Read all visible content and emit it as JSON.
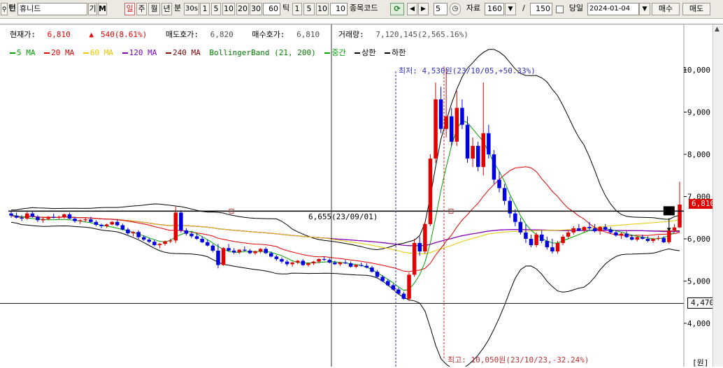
{
  "toolbar": {
    "search_icon": "search-icon",
    "search_prefix": "턴",
    "stock_name": "휴니드",
    "btn_gi": "기",
    "btn_m": "M",
    "period_day": "일",
    "period_week": "주",
    "period_month": "월",
    "period_year": "년",
    "minute_label": "분",
    "interval_30s": "30s",
    "interval_1": "1",
    "interval_5": "5",
    "interval_10": "10",
    "interval_20": "20",
    "interval_30": "30",
    "interval_60": "60",
    "tick_label": "틱",
    "tick_1": "1",
    "tick_5": "5",
    "tick_10": "10",
    "tick_value": "10",
    "stock_code_label": "종목코드",
    "step_value": "5",
    "data_label": "자료",
    "data_count": "160",
    "slash": "/",
    "data_total": "150",
    "sameday_label": "당일",
    "date_value": "2024-01-04",
    "buy_label": "매수",
    "sell_label": "매도"
  },
  "info": {
    "price_label": "현재가:",
    "price_value": "6,810",
    "change_value": "540(8.61%)",
    "ask_label": "매도호가:",
    "ask_value": "6,820",
    "bid_label": "매수호가:",
    "bid_value": "6,810",
    "volume_label": "거래량:",
    "volume_value": "7,120,145(2,565.16%)"
  },
  "legend": [
    {
      "label": "5 MA",
      "color": "#00a000"
    },
    {
      "label": "20 MA",
      "color": "#e00000"
    },
    {
      "label": "60 MA",
      "color": "#e8c800"
    },
    {
      "label": "120 MA",
      "color": "#8000c0"
    },
    {
      "label": "240 MA",
      "color": "#800000"
    },
    {
      "label": "BollingerBand (21, 200)",
      "color": "#008000"
    },
    {
      "label": "중간",
      "color": "#00a000"
    },
    {
      "label": "상한",
      "color": "#000000"
    },
    {
      "label": "하한",
      "color": "#000000"
    }
  ],
  "annotations": {
    "low_note": "최저: 4,530원(23/10/05,+50.33%)",
    "high_note": "최고: 10,050원(23/10/23,-32.24%)",
    "crosshair_note": "6,655(23/09/01)",
    "current_price_tag": "6,810",
    "cursor_price_tag": "4,470",
    "unit_label": "[원]"
  },
  "colors": {
    "up": "#e00000",
    "down": "#0000e0",
    "ma5": "#00a000",
    "ma20": "#e00000",
    "ma60": "#e8c800",
    "ma120": "#8000c0",
    "ma240": "#800000",
    "band": "#000000"
  },
  "chart_data": {
    "type": "candlestick",
    "y_unit": "원",
    "ylim": [
      3000,
      10500
    ],
    "y_ticks": [
      4000,
      5000,
      6000,
      7000,
      8000,
      9000,
      10000
    ],
    "y_tick_labels": [
      "4,000",
      "5,000",
      "6,000",
      "7,000",
      "8,000",
      "9,000",
      "10,000"
    ],
    "horizontal_line": 6655,
    "cursor_line": 4470,
    "current_price": 6810,
    "period_low": {
      "value": 4530,
      "date": "23/10/05"
    },
    "period_high": {
      "value": 10050,
      "date": "23/10/23"
    },
    "candles": [
      [
        6600,
        6650,
        6500,
        6550
      ],
      [
        6550,
        6620,
        6480,
        6500
      ],
      [
        6500,
        6560,
        6420,
        6480
      ],
      [
        6480,
        6640,
        6450,
        6600
      ],
      [
        6600,
        6660,
        6500,
        6520
      ],
      [
        6520,
        6560,
        6400,
        6440
      ],
      [
        6440,
        6500,
        6380,
        6470
      ],
      [
        6470,
        6540,
        6440,
        6520
      ],
      [
        6520,
        6600,
        6480,
        6500
      ],
      [
        6500,
        6550,
        6460,
        6520
      ],
      [
        6520,
        6600,
        6480,
        6580
      ],
      [
        6580,
        6620,
        6460,
        6480
      ],
      [
        6480,
        6520,
        6380,
        6420
      ],
      [
        6420,
        6460,
        6350,
        6440
      ],
      [
        6440,
        6500,
        6400,
        6460
      ],
      [
        6460,
        6520,
        6380,
        6400
      ],
      [
        6400,
        6440,
        6300,
        6330
      ],
      [
        6330,
        6360,
        6250,
        6300
      ],
      [
        6300,
        6360,
        6260,
        6340
      ],
      [
        6340,
        6420,
        6320,
        6400
      ],
      [
        6400,
        6460,
        6300,
        6320
      ],
      [
        6320,
        6360,
        6200,
        6220
      ],
      [
        6220,
        6260,
        6100,
        6130
      ],
      [
        6130,
        6180,
        6060,
        6160
      ],
      [
        6160,
        6200,
        6000,
        6040
      ],
      [
        6040,
        6080,
        5950,
        5980
      ],
      [
        5980,
        6020,
        5900,
        5930
      ],
      [
        5930,
        5980,
        5820,
        5850
      ],
      [
        5850,
        5900,
        5780,
        5880
      ],
      [
        5880,
        5960,
        5840,
        5940
      ],
      [
        5940,
        6000,
        5900,
        5960
      ],
      [
        5960,
        6760,
        5900,
        6620
      ],
      [
        6620,
        6680,
        6150,
        6200
      ],
      [
        6200,
        6250,
        6080,
        6120
      ],
      [
        6120,
        6160,
        6020,
        6060
      ],
      [
        6060,
        6120,
        5980,
        6000
      ],
      [
        6000,
        6060,
        5900,
        5920
      ],
      [
        5920,
        5980,
        5820,
        5840
      ],
      [
        5840,
        5880,
        5680,
        5720
      ],
      [
        5720,
        5880,
        5300,
        5380
      ],
      [
        5380,
        5800,
        5360,
        5780
      ],
      [
        5780,
        5880,
        5700,
        5720
      ],
      [
        5720,
        5780,
        5640,
        5680
      ],
      [
        5680,
        5760,
        5640,
        5740
      ],
      [
        5740,
        5820,
        5700,
        5720
      ],
      [
        5720,
        5760,
        5640,
        5660
      ],
      [
        5660,
        5720,
        5620,
        5700
      ],
      [
        5700,
        5780,
        5660,
        5760
      ],
      [
        5760,
        5800,
        5640,
        5660
      ],
      [
        5660,
        5700,
        5560,
        5580
      ],
      [
        5580,
        5620,
        5480,
        5520
      ],
      [
        5520,
        5560,
        5420,
        5460
      ],
      [
        5460,
        5500,
        5360,
        5400
      ],
      [
        5400,
        5460,
        5340,
        5440
      ],
      [
        5440,
        5500,
        5400,
        5480
      ],
      [
        5480,
        5520,
        5360,
        5380
      ],
      [
        5380,
        5440,
        5340,
        5420
      ],
      [
        5420,
        5480,
        5380,
        5460
      ],
      [
        5460,
        5540,
        5420,
        5520
      ],
      [
        5520,
        5580,
        5480,
        5500
      ],
      [
        5500,
        5540,
        5420,
        5440
      ],
      [
        5440,
        5480,
        5380,
        5400
      ],
      [
        5400,
        5460,
        5360,
        5440
      ],
      [
        5440,
        5500,
        5400,
        5420
      ],
      [
        5420,
        5460,
        5320,
        5340
      ],
      [
        5340,
        5400,
        5300,
        5380
      ],
      [
        5380,
        5440,
        5340,
        5360
      ],
      [
        5360,
        5420,
        5300,
        5320
      ],
      [
        5320,
        5360,
        5200,
        5220
      ],
      [
        5220,
        5260,
        5080,
        5100
      ],
      [
        5100,
        5140,
        4980,
        5000
      ],
      [
        5000,
        5040,
        4880,
        4900
      ],
      [
        4900,
        4940,
        4780,
        4800
      ],
      [
        4800,
        4840,
        4680,
        4700
      ],
      [
        4700,
        4740,
        4560,
        4580
      ],
      [
        4580,
        5200,
        4530,
        5150
      ],
      [
        5150,
        6000,
        5100,
        5900
      ],
      [
        5900,
        6050,
        5600,
        5700
      ],
      [
        5700,
        6400,
        5650,
        6350
      ],
      [
        6350,
        8000,
        6300,
        7900
      ],
      [
        7900,
        9700,
        7800,
        9300
      ],
      [
        9300,
        9600,
        8500,
        8600
      ],
      [
        8600,
        10050,
        8400,
        8900
      ],
      [
        8900,
        9100,
        8200,
        8300
      ],
      [
        8300,
        9500,
        8200,
        9100
      ],
      [
        9100,
        9300,
        8600,
        8700
      ],
      [
        8700,
        8900,
        7800,
        7900
      ],
      [
        7900,
        8400,
        7700,
        8200
      ],
      [
        8200,
        8300,
        7600,
        7700
      ],
      [
        7700,
        9700,
        7500,
        8500
      ],
      [
        8500,
        8700,
        7900,
        8000
      ],
      [
        8000,
        8100,
        7300,
        7400
      ],
      [
        7400,
        7600,
        7100,
        7200
      ],
      [
        7200,
        7300,
        6800,
        6900
      ],
      [
        6900,
        7000,
        6500,
        6600
      ],
      [
        6600,
        6700,
        6300,
        6400
      ],
      [
        6400,
        6500,
        6100,
        6150
      ],
      [
        6150,
        6350,
        5900,
        6000
      ],
      [
        6000,
        6100,
        5800,
        5850
      ],
      [
        5850,
        6150,
        5800,
        6100
      ],
      [
        6100,
        6200,
        5900,
        5950
      ],
      [
        5950,
        6050,
        5750,
        5800
      ],
      [
        5800,
        6000,
        5650,
        5700
      ],
      [
        5700,
        5950,
        5650,
        5900
      ],
      [
        5900,
        6100,
        5850,
        6050
      ],
      [
        6050,
        6200,
        6000,
        6150
      ],
      [
        6150,
        6300,
        6100,
        6250
      ],
      [
        6250,
        6350,
        6180,
        6200
      ],
      [
        6200,
        6300,
        6150,
        6280
      ],
      [
        6280,
        6400,
        6200,
        6250
      ],
      [
        6250,
        6350,
        6150,
        6180
      ],
      [
        6180,
        6300,
        6100,
        6280
      ],
      [
        6280,
        6350,
        6200,
        6220
      ],
      [
        6220,
        6280,
        6120,
        6150
      ],
      [
        6150,
        6200,
        6050,
        6080
      ],
      [
        6080,
        6150,
        6000,
        6120
      ],
      [
        6120,
        6180,
        6020,
        6040
      ],
      [
        6040,
        6100,
        5960,
        5980
      ],
      [
        5980,
        6060,
        5940,
        6040
      ],
      [
        6040,
        6100,
        5980,
        6000
      ],
      [
        6000,
        6060,
        5920,
        5950
      ],
      [
        5950,
        6020,
        5900,
        6000
      ],
      [
        6000,
        6080,
        5960,
        6020
      ],
      [
        6020,
        6060,
        5900,
        5920
      ],
      [
        5920,
        6250,
        5880,
        6200
      ],
      [
        6200,
        6350,
        6150,
        6270
      ],
      [
        6270,
        7350,
        6250,
        6810
      ]
    ],
    "ma5": [
      6560,
      6540,
      6520,
      6500,
      6480,
      6470,
      6460,
      6450,
      6450,
      6460,
      6460,
      6450,
      6440,
      6420,
      6400,
      6380,
      6350,
      6320,
      6300,
      6280,
      6250,
      6220,
      6190,
      6150,
      6110,
      6070,
      6020,
      5980,
      5940,
      5930,
      5960,
      6050,
      6100,
      6150,
      6180,
      6120,
      6050,
      5980,
      5900,
      5820,
      5750,
      5700,
      5680,
      5680,
      5700,
      5700,
      5700,
      5700,
      5700,
      5680,
      5640,
      5600,
      5540,
      5480,
      5440,
      5430,
      5430,
      5430,
      5440,
      5450,
      5460,
      5460,
      5440,
      5430,
      5410,
      5390,
      5370,
      5330,
      5270,
      5200,
      5120,
      5040,
      4960,
      4860,
      4780,
      4800,
      4950,
      5150,
      5450,
      5900,
      6500,
      7150,
      7700,
      8200,
      8600,
      8800,
      8750,
      8600,
      8450,
      8300,
      8050,
      7800,
      7600,
      7350,
      7050,
      6800,
      6550,
      6350,
      6200,
      6100,
      6000,
      5950,
      5900,
      5900,
      5950,
      6000,
      6050,
      6100,
      6150,
      6200,
      6220,
      6230,
      6240,
      6220,
      6190,
      6160,
      6120,
      6090,
      6060,
      6040,
      6020,
      6000,
      6000,
      6030,
      6080,
      6150
    ]
  }
}
